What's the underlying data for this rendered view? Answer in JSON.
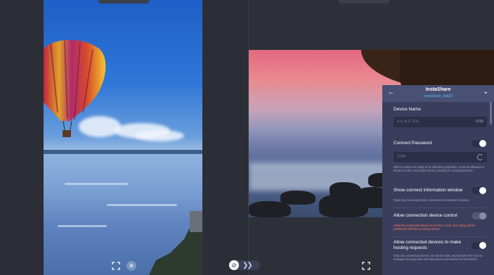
{
  "left_controls": {
    "fullscreen_icon": "fullscreen-icon",
    "close_glyph": "✕"
  },
  "middle_controls": {
    "link_glyph": "⊘",
    "next_glyph": "❯❯"
  },
  "panel": {
    "title": "InstaShare",
    "subtitle": "InstaShare_dab33",
    "back_glyph": "←",
    "collapse_glyph": "⌄",
    "device_name": {
      "label": "Device Name",
      "placeholder": "a-z, A-Z, 0-9",
      "counter": "0/16"
    },
    "connect_password": {
      "label": "Connect Password",
      "value": "1234",
      "enabled": true,
      "description": "When a device is ready to be Wireless projection, it can be allowed or denied on the connection device (master) or receiving device."
    },
    "show_info": {
      "label": "Show connect information window",
      "enabled": true,
      "description": "Open the receiving device connection information window"
    },
    "allow_control": {
      "label": "Allow connection device control",
      "enabled": false,
      "description": "Allow the connected device to be the in area, then drag and be positioned with the receiving device"
    },
    "allow_hosting": {
      "label": "Allow connected devices to make hosting requests",
      "enabled": true,
      "description": "Only one connected device can be the host, and become the host to manage the projection and interaction permissions of all devices"
    }
  },
  "colors": {
    "panel_bg": "#3a3e5c",
    "accent_link": "#4fc3f7",
    "warning": "#ff7a6a"
  }
}
